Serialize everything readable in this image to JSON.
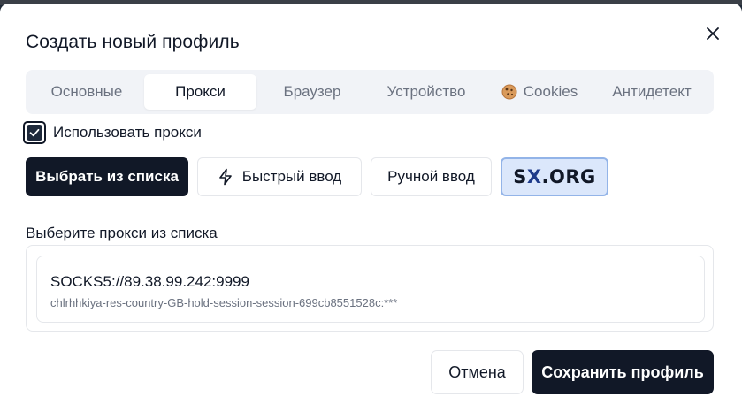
{
  "dialog": {
    "title": "Создать новый профиль",
    "close_icon": "close-icon"
  },
  "tabs": [
    {
      "label": "Основные",
      "active": false
    },
    {
      "label": "Прокси",
      "active": true
    },
    {
      "label": "Браузер",
      "active": false
    },
    {
      "label": "Устройство",
      "active": false
    },
    {
      "label": "Cookies",
      "active": false,
      "icon": "cookie-icon"
    },
    {
      "label": "Антидетект",
      "active": false
    }
  ],
  "use_proxy": {
    "label": "Использовать прокси",
    "checked": true
  },
  "modes": {
    "from_list": "Выбрать из списка",
    "quick_input": "Быстрый ввод",
    "quick_input_icon": "lightning-icon",
    "manual_input": "Ручной ввод",
    "provider_prefix": "S",
    "provider_mid": "X",
    "provider_suffix": ".ORG",
    "selected": "from_list"
  },
  "proxy_list": {
    "label": "Выберите прокси из списка",
    "items": [
      {
        "address": "SOCKS5://89.38.99.242:9999",
        "login": "chlrhhkiya-res-country-GB-hold-session-session-699cb8551528c:***"
      }
    ]
  },
  "footer": {
    "cancel": "Отмена",
    "save": "Сохранить профиль"
  },
  "colors": {
    "primary": "#111827",
    "tab_bg": "#f1f3f7",
    "sx_bg": "#dbe7fb",
    "sx_border": "#93b4e8"
  }
}
